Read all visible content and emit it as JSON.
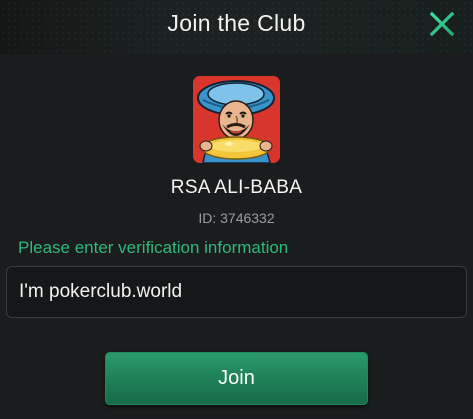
{
  "dialog": {
    "title": "Join the Club",
    "close_icon": "close-x-icon",
    "accent_color": "#2fb97c"
  },
  "club": {
    "avatar": "club-avatar-genie",
    "name": "RSA ALI-BABA",
    "id_text": "ID: 3746332"
  },
  "form": {
    "prompt": "Please enter verification information",
    "input_value": "I'm pokerclub.world",
    "join_label": "Join"
  }
}
